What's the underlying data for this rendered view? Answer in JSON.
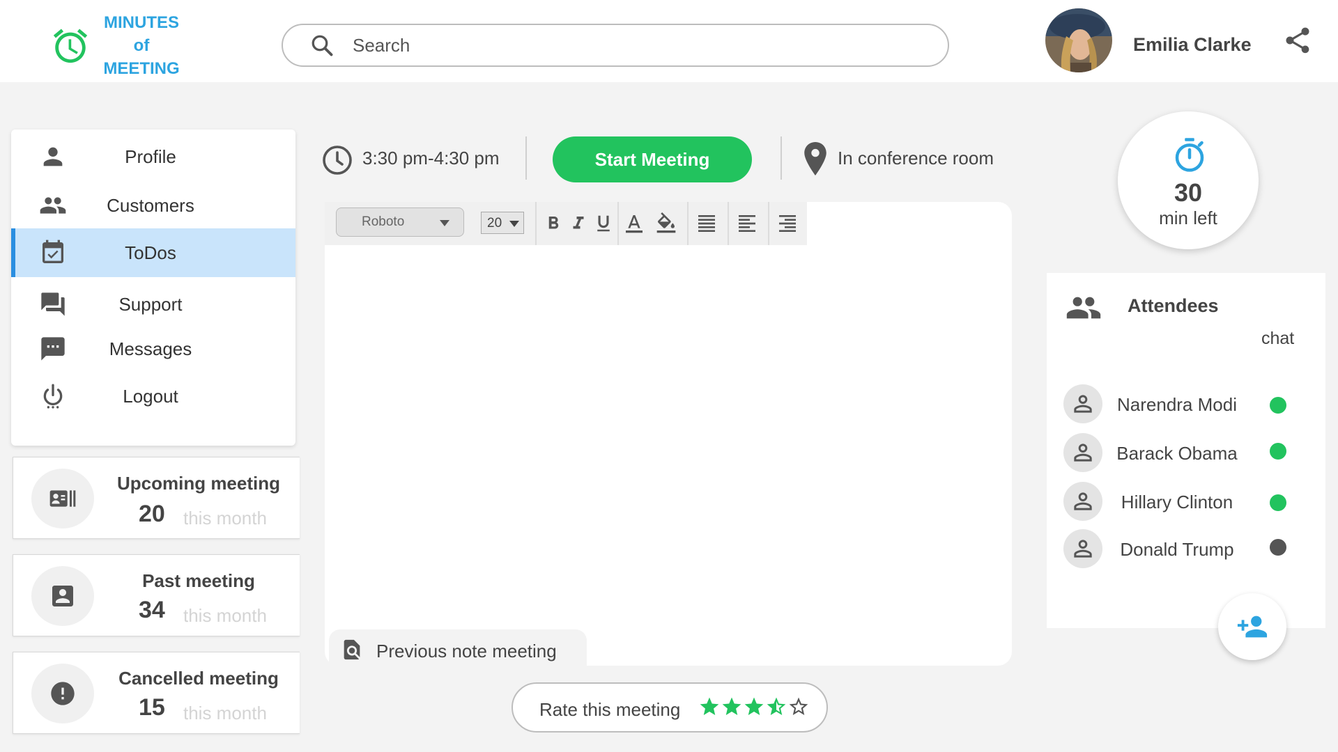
{
  "app": {
    "logo_line1": "MINUTES",
    "logo_line2": "of",
    "logo_line3": "MEETING",
    "brand_color": "#2da4e0"
  },
  "search": {
    "placeholder": "Search",
    "value": ""
  },
  "user": {
    "name": "Emilia Clarke"
  },
  "sidebar": {
    "items": [
      {
        "label": "Profile",
        "icon": "person-icon"
      },
      {
        "label": "Customers",
        "icon": "people-icon"
      },
      {
        "label": "ToDos",
        "icon": "calendar-check-icon",
        "active": true
      },
      {
        "label": "Support",
        "icon": "forum-icon"
      },
      {
        "label": "Messages",
        "icon": "chat-dots-icon"
      },
      {
        "label": "Logout",
        "icon": "power-icon"
      }
    ]
  },
  "stats": [
    {
      "title": "Upcoming meeting",
      "count": "20",
      "period": "this month",
      "icon": "contacts-card-icon"
    },
    {
      "title": "Past meeting",
      "count": "34",
      "period": "this month",
      "icon": "account-box-icon"
    },
    {
      "title": "Cancelled meeting",
      "count": "15",
      "period": "this month",
      "icon": "alert-circle-icon"
    }
  ],
  "meeting": {
    "time_range": "3:30 pm-4:30 pm",
    "start_label": "Start Meeting",
    "location": "In conference room",
    "accent_color": "#22c35e"
  },
  "editor": {
    "font": "Roboto",
    "size": "20",
    "tools": [
      "bold",
      "italic",
      "underline",
      "text-color",
      "fill-color",
      "justify",
      "align-left",
      "align-right"
    ]
  },
  "previous_note": {
    "label": "Previous note meeting"
  },
  "rating": {
    "label": "Rate this meeting",
    "value": 3.5,
    "max": 5
  },
  "timer": {
    "value": "30",
    "label": "min left"
  },
  "attendees": {
    "title": "Attendees",
    "chat_label": "chat",
    "list": [
      {
        "name": "Narendra Modi",
        "status": "online",
        "status_color": "#22c35e"
      },
      {
        "name": "Barack Obama",
        "status": "online",
        "status_color": "#22c35e"
      },
      {
        "name": "Hillary Clinton",
        "status": "online",
        "status_color": "#22c35e"
      },
      {
        "name": "Donald Trump",
        "status": "offline",
        "status_color": "#555555"
      }
    ]
  }
}
